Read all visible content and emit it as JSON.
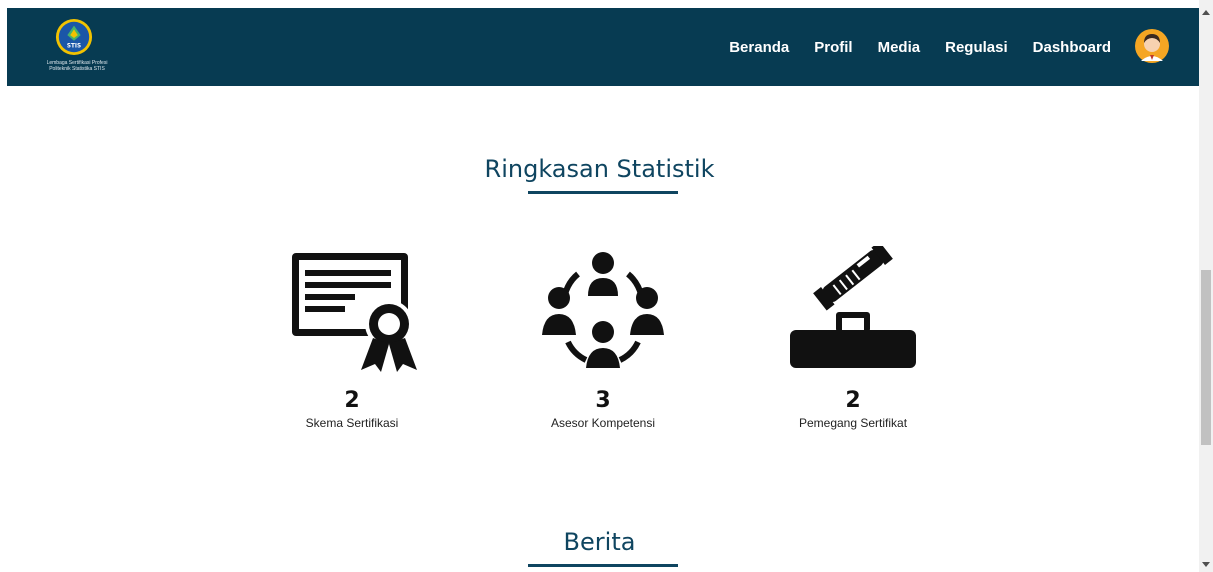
{
  "brand": {
    "logo_name": "lsp-stis-logo",
    "logo_badge": "STIS",
    "logo_line1": "Lembaga Sertifikasi Profesi",
    "logo_line2": "Politeknik Statistika STIS"
  },
  "nav": {
    "items": [
      "Beranda",
      "Profil",
      "Media",
      "Regulasi",
      "Dashboard"
    ],
    "avatar_icon": "user-avatar-icon"
  },
  "stats_section": {
    "title": "Ringkasan Statistik",
    "items": [
      {
        "icon": "certificate-icon",
        "value": "2",
        "label": "Skema Sertifikasi"
      },
      {
        "icon": "group-icon",
        "value": "3",
        "label": "Asesor Kompetensi"
      },
      {
        "icon": "handshake-briefcase-icon",
        "value": "2",
        "label": "Pemegang Sertifikat"
      }
    ]
  },
  "news_section": {
    "title": "Berita"
  },
  "colors": {
    "navbar": "#073b52",
    "accent": "#0f4560"
  }
}
